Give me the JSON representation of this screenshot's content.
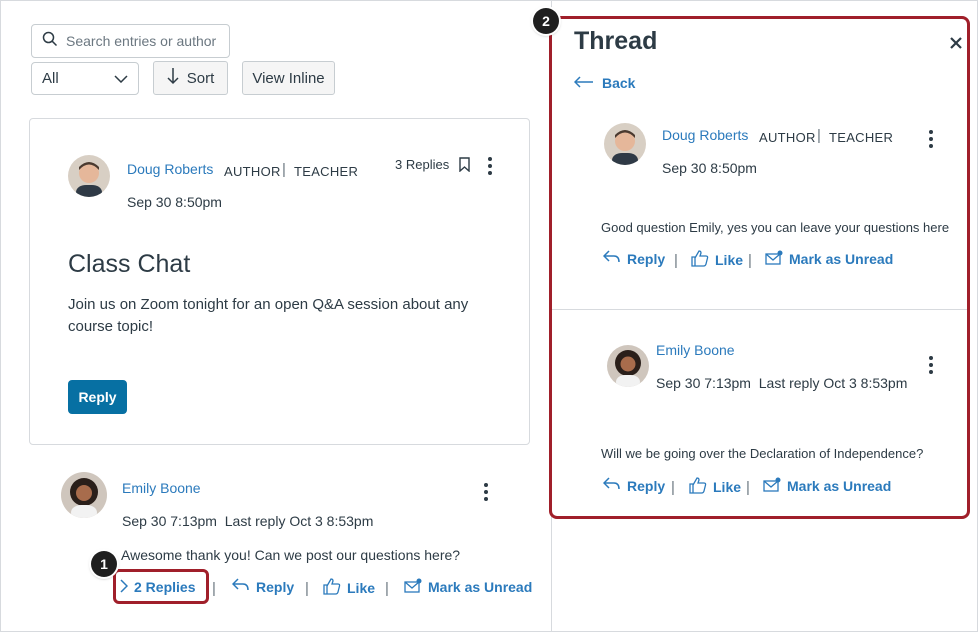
{
  "filters": {
    "search_placeholder": "Search entries or author",
    "view_select": "All",
    "sort_label": "Sort",
    "view_inline_label": "View Inline"
  },
  "topic": {
    "author": "Doug Roberts",
    "role_author": "AUTHOR",
    "role_teacher": "TEACHER",
    "date": "Sep 30 8:50pm",
    "replies_count": "3 Replies",
    "title": "Class Chat",
    "body": "Join us on Zoom tonight for an open Q&A session about any course topic!",
    "reply_button": "Reply"
  },
  "entry": {
    "author": "Emily Boone",
    "date": "Sep 30 7:13pm",
    "last_reply": "Last reply Oct 3 8:53pm",
    "message": "Awesome thank you! Can we post our questions here?",
    "replies_toggle": "2 Replies",
    "reply": "Reply",
    "like": "Like",
    "mark_unread": "Mark as Unread"
  },
  "thread": {
    "title": "Thread",
    "back": "Back",
    "post1": {
      "author": "Doug Roberts",
      "role_author": "AUTHOR",
      "role_teacher": "TEACHER",
      "date": "Sep 30 8:50pm",
      "message": "Good question Emily, yes you can leave your questions here",
      "reply": "Reply",
      "like": "Like",
      "mark_unread": "Mark as Unread"
    },
    "post2": {
      "author": "Emily Boone",
      "date": "Sep 30 7:13pm",
      "last_reply": "Last reply Oct 3 8:53pm",
      "message": "Will we be going over the Declaration of Independence?",
      "reply": "Reply",
      "like": "Like",
      "mark_unread": "Mark as Unread"
    }
  },
  "callouts": {
    "one": "1",
    "two": "2"
  },
  "colors": {
    "link": "#2b7abc",
    "primary_button": "#0770a3",
    "highlight": "#a01f2a"
  }
}
